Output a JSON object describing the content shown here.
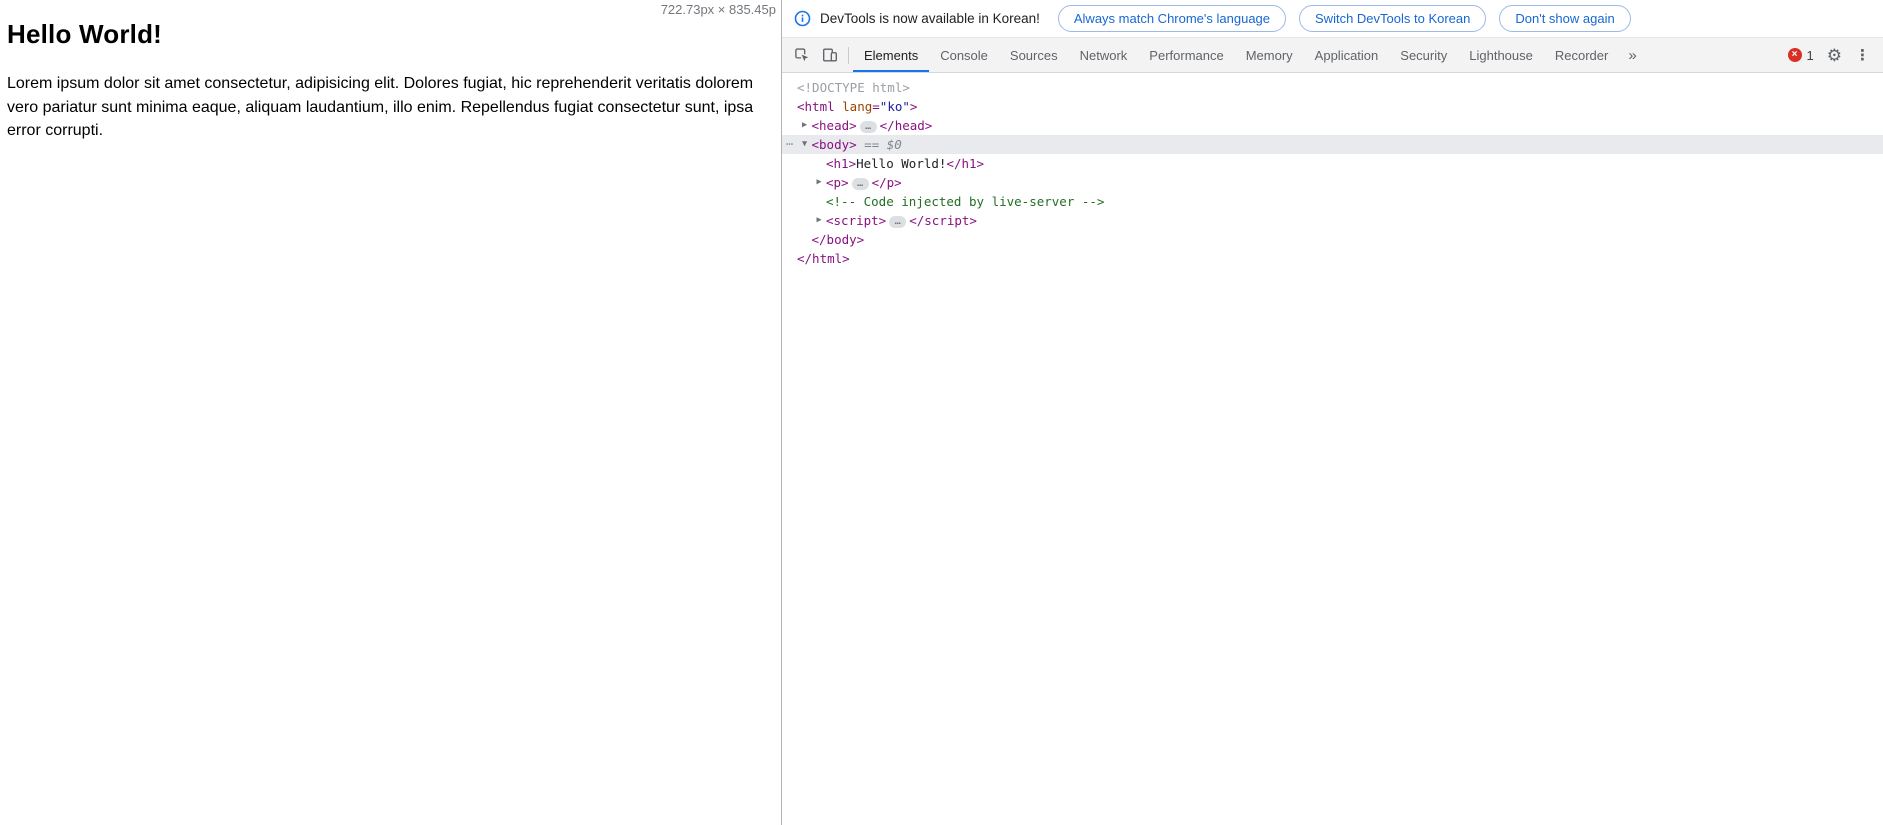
{
  "page": {
    "heading": "Hello World!",
    "body_text": "Lorem ipsum dolor sit amet consectetur, adipisicing elit. Dolores fugiat, hic reprehenderit veritatis dolorem vero pariatur sunt minima eaque, aliquam laudantium, illo enim. Repellendus fugiat consectetur sunt, ipsa error corrupti.",
    "size_overlay": "722.73px × 835.45p"
  },
  "icons": {
    "more_tabs": "»",
    "settings": "⚙",
    "menu": "⋮",
    "error": "×",
    "arrow_collapsed": "▶",
    "arrow_expanded": "▼"
  },
  "devtools": {
    "banner": {
      "message": "DevTools is now available in Korean!",
      "buttons": [
        {
          "label": "Always match Chrome's language"
        },
        {
          "label": "Switch DevTools to Korean"
        },
        {
          "label": "Don't show again"
        }
      ]
    },
    "tabs": {
      "items": [
        "Elements",
        "Console",
        "Sources",
        "Network",
        "Performance",
        "Memory",
        "Application",
        "Security",
        "Lighthouse",
        "Recorder"
      ],
      "selected": "Elements"
    },
    "status": {
      "error_count": "1"
    },
    "dom_tree": {
      "rows": [
        {
          "indent": 0,
          "arrow": null,
          "selected": false,
          "tokens": [
            {
              "t": "doctype",
              "s": "<!DOCTYPE html>"
            }
          ]
        },
        {
          "indent": 0,
          "arrow": null,
          "selected": false,
          "tokens": [
            {
              "t": "tag",
              "s": "<html "
            },
            {
              "t": "attr",
              "s": "lang"
            },
            {
              "t": "tag",
              "s": "="
            },
            {
              "t": "val",
              "s": "\"ko\""
            },
            {
              "t": "tag",
              "s": ">"
            }
          ]
        },
        {
          "indent": 1,
          "arrow": "collapsed",
          "selected": false,
          "tokens": [
            {
              "t": "tag",
              "s": "<head>"
            },
            {
              "t": "ellipsis",
              "s": "…"
            },
            {
              "t": "tag",
              "s": "</head>"
            }
          ]
        },
        {
          "indent": 1,
          "arrow": "expanded",
          "selected": true,
          "gutter": "…",
          "tokens": [
            {
              "t": "tag",
              "s": "<body>"
            },
            {
              "t": "meta",
              "s": " == $0"
            }
          ]
        },
        {
          "indent": 2,
          "arrow": null,
          "selected": false,
          "tokens": [
            {
              "t": "tag",
              "s": "<h1>"
            },
            {
              "t": "text",
              "s": "Hello World!"
            },
            {
              "t": "tag",
              "s": "</h1>"
            }
          ]
        },
        {
          "indent": 2,
          "arrow": "collapsed",
          "selected": false,
          "tokens": [
            {
              "t": "tag",
              "s": "<p>"
            },
            {
              "t": "ellipsis",
              "s": "…"
            },
            {
              "t": "tag",
              "s": "</p>"
            }
          ]
        },
        {
          "indent": 2,
          "arrow": null,
          "selected": false,
          "tokens": [
            {
              "t": "comment",
              "s": "<!-- Code injected by live-server -->"
            }
          ]
        },
        {
          "indent": 2,
          "arrow": "collapsed",
          "selected": false,
          "tokens": [
            {
              "t": "tag",
              "s": "<script>"
            },
            {
              "t": "ellipsis",
              "s": "…"
            },
            {
              "t": "tag",
              "s": "</script>"
            }
          ]
        },
        {
          "indent": 1,
          "arrow": null,
          "selected": false,
          "tokens": [
            {
              "t": "tag",
              "s": "</body>"
            }
          ]
        },
        {
          "indent": 0,
          "arrow": null,
          "selected": false,
          "tokens": [
            {
              "t": "tag",
              "s": "</html>"
            }
          ]
        }
      ]
    }
  },
  "colors": {
    "accent_blue": "#1a73e8",
    "tag": "#881280",
    "attr_name": "#994500",
    "attr_value": "#1a1aa6",
    "comment": "#236e25",
    "error_red": "#d93025",
    "selected_row": "#e8eaed"
  }
}
